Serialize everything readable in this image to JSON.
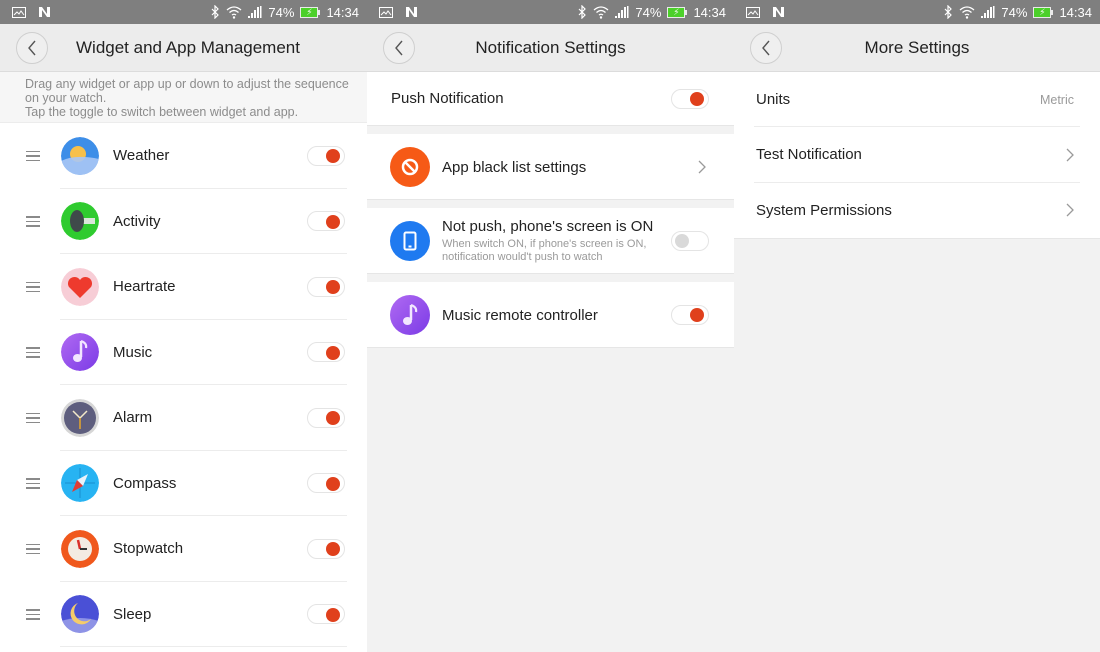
{
  "status_bar": {
    "battery_percent": "74%",
    "time": "14:34",
    "left_icons": [
      "gallery-icon",
      "nfc-icon"
    ],
    "right_icons": [
      "bluetooth-icon",
      "wifi-icon",
      "signal-icon",
      "battery-charging-icon"
    ]
  },
  "colors": {
    "accent_toggle_on": "#e0401c",
    "toggle_off_knob": "#d9d9d9",
    "status_bar": "#7f7f7f",
    "header_bg": "#ececec"
  },
  "widget_screen": {
    "title": "Widget and App Management",
    "hint_lines": [
      "Drag any widget or app up or down to adjust the sequence on your watch.",
      "Tap the toggle to switch between widget and app."
    ],
    "items": [
      {
        "label": "Weather",
        "icon": "weather-icon",
        "enabled": true
      },
      {
        "label": "Activity",
        "icon": "activity-icon",
        "enabled": true
      },
      {
        "label": "Heartrate",
        "icon": "heartrate-icon",
        "enabled": true
      },
      {
        "label": "Music",
        "icon": "music-icon",
        "enabled": true
      },
      {
        "label": "Alarm",
        "icon": "alarm-icon",
        "enabled": true
      },
      {
        "label": "Compass",
        "icon": "compass-icon",
        "enabled": true
      },
      {
        "label": "Stopwatch",
        "icon": "stopwatch-icon",
        "enabled": true
      },
      {
        "label": "Sleep",
        "icon": "sleep-icon",
        "enabled": true
      }
    ]
  },
  "notification_screen": {
    "title": "Notification Settings",
    "push_notification": {
      "label": "Push Notification",
      "enabled": true
    },
    "black_list": {
      "label": "App black list settings",
      "icon": "block-icon"
    },
    "screen_on": {
      "label": "Not push, phone's screen is ON",
      "description_lines": [
        "When switch ON, if phone's screen is ON,",
        "notification would't push to watch"
      ],
      "icon": "phone-icon",
      "enabled": false
    },
    "music_remote": {
      "label": "Music remote controller",
      "icon": "music-icon",
      "enabled": true
    }
  },
  "more_settings_screen": {
    "title": "More Settings",
    "items": [
      {
        "label": "Units",
        "value": "Metric"
      },
      {
        "label": "Test Notification"
      },
      {
        "label": "System Permissions"
      }
    ]
  }
}
